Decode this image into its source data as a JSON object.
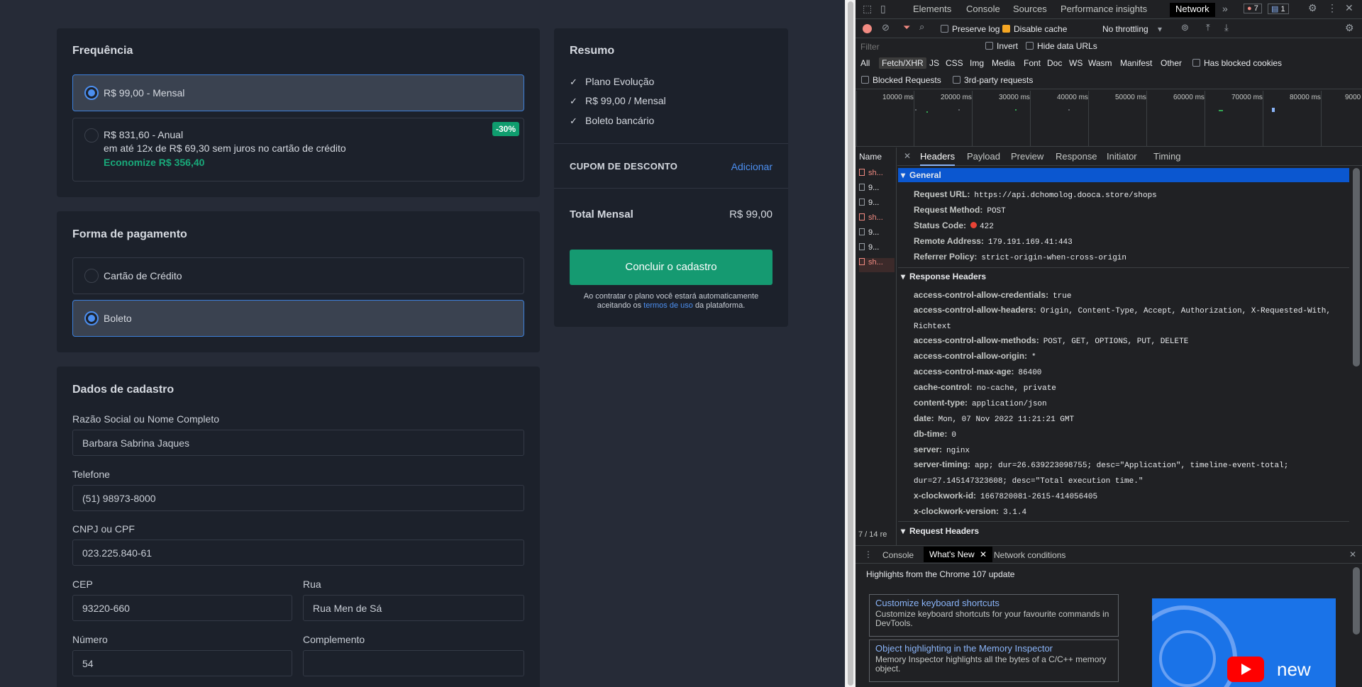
{
  "frequency": {
    "title": "Frequência",
    "monthly_label": "R$ 99,00 - Mensal",
    "annual_label": "R$ 831,60 - Anual",
    "annual_installments": "em até 12x de R$ 69,30 sem juros no cartão de crédito",
    "annual_savings": "Economize R$ 356,40",
    "annual_badge": "-30%",
    "selected": "monthly"
  },
  "payment": {
    "title": "Forma de pagamento",
    "credit_card_label": "Cartão de Crédito",
    "boleto_label": "Boleto",
    "selected": "boleto"
  },
  "registration": {
    "title": "Dados de cadastro",
    "name_label": "Razão Social ou Nome Completo",
    "name_value": "Barbara Sabrina Jaques",
    "phone_label": "Telefone",
    "phone_value": "(51) 98973-8000",
    "doc_label": "CNPJ ou CPF",
    "doc_value": "023.225.840-61",
    "cep_label": "CEP",
    "cep_value": "93220-660",
    "street_label": "Rua",
    "street_value": "Rua Men de Sá",
    "number_label": "Número",
    "number_value": "54",
    "complement_label": "Complemento",
    "complement_value": ""
  },
  "summary": {
    "title": "Resumo",
    "items": [
      "Plano Evolução",
      "R$ 99,00 / Mensal",
      "Boleto bancário"
    ],
    "coupon_label": "CUPOM DE DESCONTO",
    "coupon_action": "Adicionar",
    "total_label": "Total Mensal",
    "total_value": "R$ 99,00",
    "submit_label": "Concluir o cadastro",
    "terms_pre": "Ao contratar o plano você estará automaticamente aceitando os",
    "terms_link": "termos de uso",
    "terms_post": "da plataforma."
  },
  "devtools": {
    "tabs": [
      "Elements",
      "Console",
      "Sources",
      "Performance insights",
      "Network"
    ],
    "active_tab": "Network",
    "error_count": "7",
    "message_count": "1",
    "toolbar": {
      "preserve_log": "Preserve log",
      "disable_cache": "Disable cache",
      "throttling": "No throttling"
    },
    "filter_placeholder": "Filter",
    "invert": "Invert",
    "hide_data_urls": "Hide data URLs",
    "types": [
      "All",
      "Fetch/XHR",
      "JS",
      "CSS",
      "Img",
      "Media",
      "Font",
      "Doc",
      "WS",
      "Wasm",
      "Manifest",
      "Other"
    ],
    "active_type": "Fetch/XHR",
    "has_blocked_cookies": "Has blocked cookies",
    "blocked_requests": "Blocked Requests",
    "third_party": "3rd-party requests",
    "timeline_ticks": [
      "10000 ms",
      "20000 ms",
      "30000 ms",
      "40000 ms",
      "50000 ms",
      "60000 ms",
      "70000 ms",
      "80000 ms",
      "9000"
    ],
    "name_header": "Name",
    "requests": [
      {
        "name": "sh...",
        "error": true
      },
      {
        "name": "9...",
        "error": false
      },
      {
        "name": "9...",
        "error": false
      },
      {
        "name": "sh...",
        "error": true
      },
      {
        "name": "9...",
        "error": false
      },
      {
        "name": "9...",
        "error": false
      },
      {
        "name": "sh...",
        "error": true
      }
    ],
    "request_count": "7 / 14 re",
    "detail_tabs": [
      "Headers",
      "Payload",
      "Preview",
      "Response",
      "Initiator",
      "Timing"
    ],
    "active_detail_tab": "Headers",
    "general_title": "General",
    "general": [
      {
        "k": "Request URL:",
        "v": "https://api.dchomolog.dooca.store/shops"
      },
      {
        "k": "Request Method:",
        "v": "POST"
      },
      {
        "k": "Status Code:",
        "v": "422"
      },
      {
        "k": "Remote Address:",
        "v": "179.191.169.41:443"
      },
      {
        "k": "Referrer Policy:",
        "v": "strict-origin-when-cross-origin"
      }
    ],
    "response_headers_title": "Response Headers",
    "response_headers": [
      {
        "k": "access-control-allow-credentials:",
        "v": "true"
      },
      {
        "k": "access-control-allow-headers:",
        "v": "Origin, Content-Type, Accept, Authorization, X-Requested-With, Richtext"
      },
      {
        "k": "access-control-allow-methods:",
        "v": "POST, GET, OPTIONS, PUT, DELETE"
      },
      {
        "k": "access-control-allow-origin:",
        "v": "*"
      },
      {
        "k": "access-control-max-age:",
        "v": "86400"
      },
      {
        "k": "cache-control:",
        "v": "no-cache, private"
      },
      {
        "k": "content-type:",
        "v": "application/json"
      },
      {
        "k": "date:",
        "v": "Mon, 07 Nov 2022 11:21:21 GMT"
      },
      {
        "k": "db-time:",
        "v": "0"
      },
      {
        "k": "server:",
        "v": "nginx"
      },
      {
        "k": "server-timing:",
        "v": "app; dur=26.639223098755; desc=\"Application\", timeline-event-total; dur=27.145147323608; desc=\"Total execution time.\""
      },
      {
        "k": "x-clockwork-id:",
        "v": "1667820081-2615-414056405"
      },
      {
        "k": "x-clockwork-version:",
        "v": "3.1.4"
      }
    ],
    "request_headers_title": "Request Headers",
    "drawer_tabs": [
      "Console",
      "What's New",
      "Network conditions"
    ],
    "active_drawer_tab": "What's New",
    "whats_new_title": "Highlights from the Chrome 107 update",
    "cards": [
      {
        "title": "Customize keyboard shortcuts",
        "desc": "Customize keyboard shortcuts for your favourite commands in DevTools."
      },
      {
        "title": "Object highlighting in the Memory Inspector",
        "desc": "Memory Inspector highlights all the bytes of a C/C++ memory object."
      }
    ],
    "video_label": "new"
  }
}
